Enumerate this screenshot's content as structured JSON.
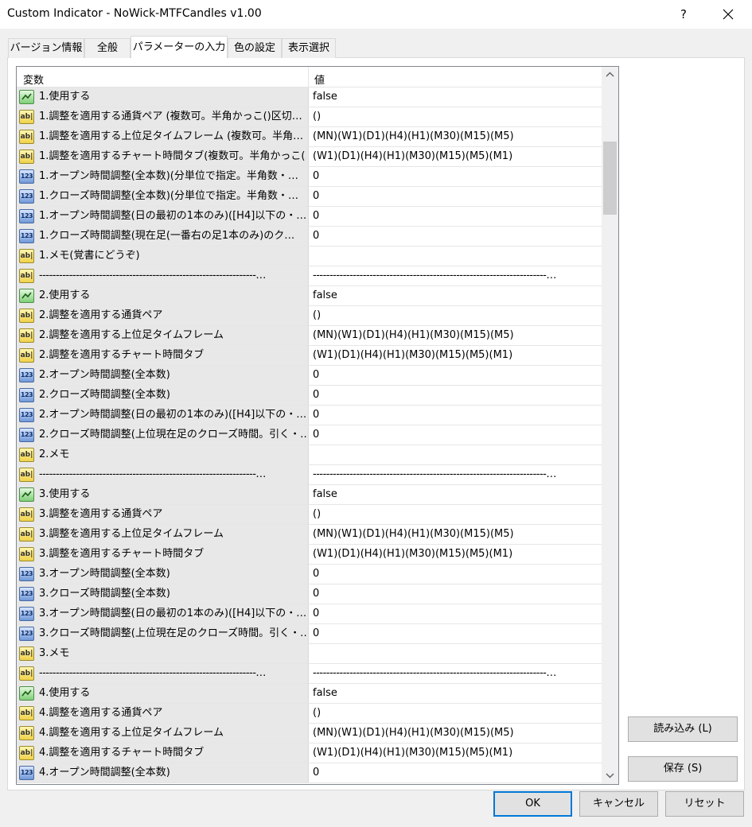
{
  "window": {
    "title": "Custom Indicator - NoWick-MTFCandles v1.00",
    "help_label": "?",
    "close_icon": "close-icon"
  },
  "tabs": [
    {
      "label": "バージョン情報",
      "active": false
    },
    {
      "label": "全般",
      "active": false
    },
    {
      "label": "パラメーターの入力",
      "active": true
    },
    {
      "label": "色の設定",
      "active": false
    },
    {
      "label": "表示選択",
      "active": false
    }
  ],
  "grid": {
    "header_variable": "変数",
    "header_value": "値",
    "rows": [
      {
        "type": "bool",
        "name": "1.使用する",
        "value": "false"
      },
      {
        "type": "ab",
        "name": "1.調整を適用する通貨ペア (複数可。半角かっこ()区切…",
        "value": "()"
      },
      {
        "type": "ab",
        "name": "1.調整を適用する上位足タイムフレーム (複数可。半角…",
        "value": "(MN)(W1)(D1)(H4)(H1)(M30)(M15)(M5)"
      },
      {
        "type": "ab",
        "name": "1.調整を適用するチャート時間タブ(複数可。半角かっこ(…",
        "value": "(W1)(D1)(H4)(H1)(M30)(M15)(M5)(M1)"
      },
      {
        "type": "n123",
        "name": "1.オープン時間調整(全本数)(分単位で指定。半角数・…",
        "value": "0"
      },
      {
        "type": "n123",
        "name": "1.クローズ時間調整(全本数)(分単位で指定。半角数・…",
        "value": "0"
      },
      {
        "type": "n123",
        "name": "1.オープン時間調整(日の最初の1本のみ)([H4]以下の・…",
        "value": "0"
      },
      {
        "type": "n123",
        "name": "1.クローズ時間調整(現在足(一番右の足1本のみ)のク…",
        "value": "0"
      },
      {
        "type": "ab",
        "name": "1.メモ(覚書にどうぞ)",
        "value": ""
      },
      {
        "type": "ab",
        "name": "-----------------------------------------------------------------…",
        "value": "----------------------------------------------------------------------…"
      },
      {
        "type": "bool",
        "name": "2.使用する",
        "value": "false"
      },
      {
        "type": "ab",
        "name": "2.調整を適用する通貨ペア",
        "value": "()"
      },
      {
        "type": "ab",
        "name": "2.調整を適用する上位足タイムフレーム",
        "value": "(MN)(W1)(D1)(H4)(H1)(M30)(M15)(M5)"
      },
      {
        "type": "ab",
        "name": "2.調整を適用するチャート時間タブ",
        "value": "(W1)(D1)(H4)(H1)(M30)(M15)(M5)(M1)"
      },
      {
        "type": "n123",
        "name": "2.オープン時間調整(全本数)",
        "value": "0"
      },
      {
        "type": "n123",
        "name": "2.クローズ時間調整(全本数)",
        "value": "0"
      },
      {
        "type": "n123",
        "name": "2.オープン時間調整(日の最初の1本のみ)([H4]以下の・…",
        "value": "0"
      },
      {
        "type": "n123",
        "name": "2.クローズ時間調整(上位現在足のクローズ時間。引く・…",
        "value": "0"
      },
      {
        "type": "ab",
        "name": "2.メモ",
        "value": ""
      },
      {
        "type": "ab",
        "name": "-----------------------------------------------------------------…",
        "value": "----------------------------------------------------------------------…"
      },
      {
        "type": "bool",
        "name": "3.使用する",
        "value": "false"
      },
      {
        "type": "ab",
        "name": "3.調整を適用する通貨ペア",
        "value": "()"
      },
      {
        "type": "ab",
        "name": "3.調整を適用する上位足タイムフレーム",
        "value": "(MN)(W1)(D1)(H4)(H1)(M30)(M15)(M5)"
      },
      {
        "type": "ab",
        "name": "3.調整を適用するチャート時間タブ",
        "value": "(W1)(D1)(H4)(H1)(M30)(M15)(M5)(M1)"
      },
      {
        "type": "n123",
        "name": "3.オープン時間調整(全本数)",
        "value": "0"
      },
      {
        "type": "n123",
        "name": "3.クローズ時間調整(全本数)",
        "value": "0"
      },
      {
        "type": "n123",
        "name": "3.オープン時間調整(日の最初の1本のみ)([H4]以下の・…",
        "value": "0"
      },
      {
        "type": "n123",
        "name": "3.クローズ時間調整(上位現在足のクローズ時間。引く・…",
        "value": "0"
      },
      {
        "type": "ab",
        "name": "3.メモ",
        "value": ""
      },
      {
        "type": "ab",
        "name": "-----------------------------------------------------------------…",
        "value": "----------------------------------------------------------------------…"
      },
      {
        "type": "bool",
        "name": "4.使用する",
        "value": "false"
      },
      {
        "type": "ab",
        "name": "4.調整を適用する通貨ペア",
        "value": "()"
      },
      {
        "type": "ab",
        "name": "4.調整を適用する上位足タイムフレーム",
        "value": "(MN)(W1)(D1)(H4)(H1)(M30)(M15)(M5)"
      },
      {
        "type": "ab",
        "name": "4.調整を適用するチャート時間タブ",
        "value": "(W1)(D1)(H4)(H1)(M30)(M15)(M5)(M1)"
      },
      {
        "type": "n123",
        "name": "4.オープン時間調整(全本数)",
        "value": "0"
      }
    ]
  },
  "icon_labels": {
    "ab": "ab|",
    "n123": "123"
  },
  "side_buttons": {
    "load": "読み込み (L)",
    "save": "保存 (S)"
  },
  "footer_buttons": {
    "ok": "OK",
    "cancel": "キャンセル",
    "reset": "リセット"
  },
  "colors": {
    "accent": "#0078d7",
    "name_cell_bg": "#e8e8e8"
  }
}
